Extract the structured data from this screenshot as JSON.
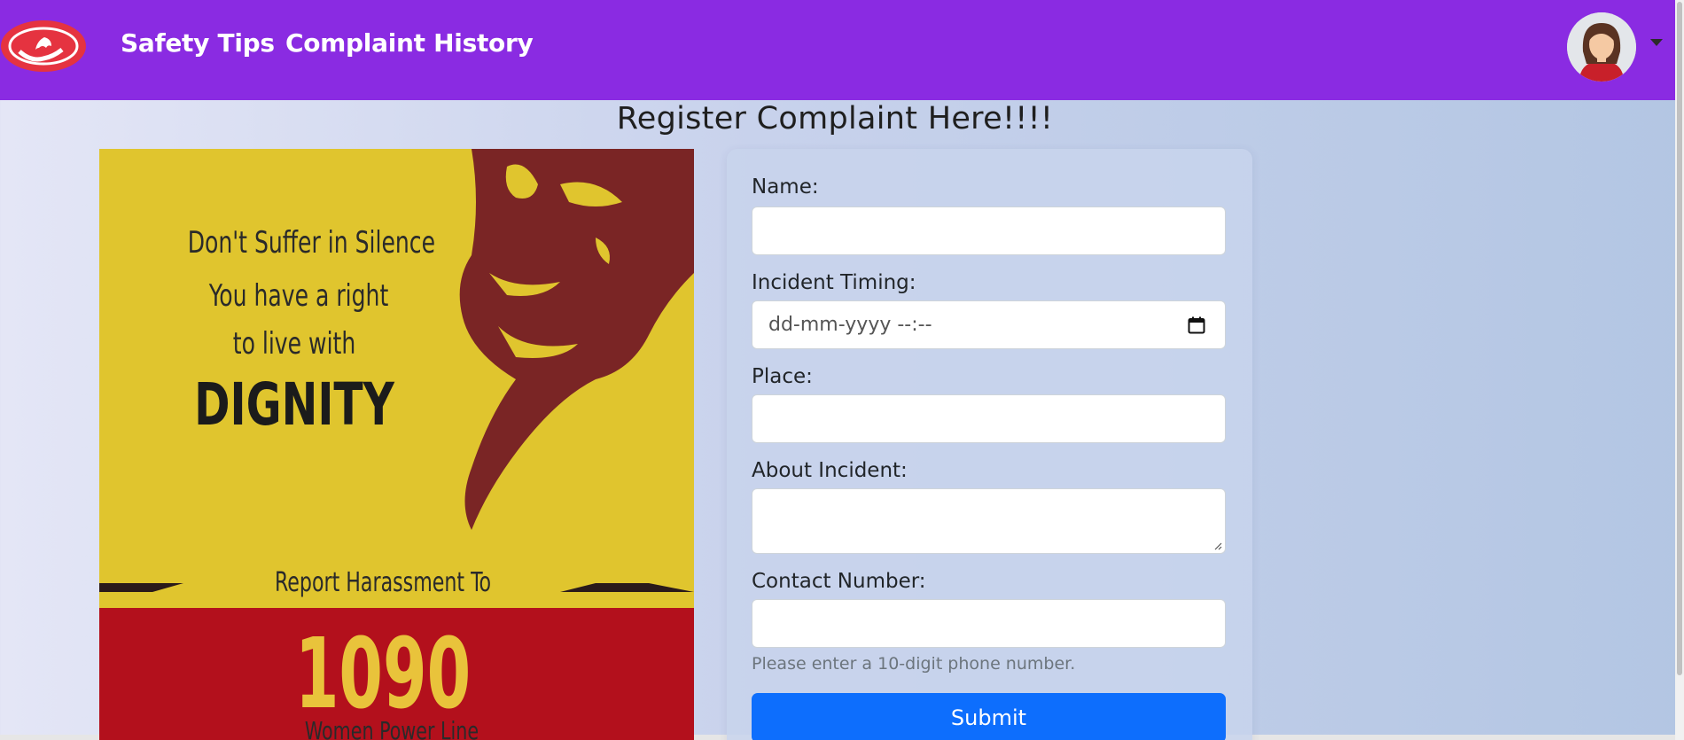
{
  "navbar": {
    "links": [
      "Safety Tips",
      "Complaint History"
    ],
    "brand_color": "#8a2be2"
  },
  "page": {
    "title": "Register Complaint Here!!!!"
  },
  "poster": {
    "line1": "Don't Suffer in Silence",
    "line2": "You have a right",
    "line3": "to live with",
    "line4": "DIGNITY",
    "line5": "Report Harassment To",
    "number": "1090",
    "line6": "Women Power Line"
  },
  "form": {
    "name_label": "Name:",
    "name_value": "",
    "timing_label": "Incident Timing:",
    "timing_placeholder": "dd-mm-yyyy --:--",
    "place_label": "Place:",
    "place_value": "",
    "about_label": "About Incident:",
    "about_value": "",
    "contact_label": "Contact Number:",
    "contact_value": "",
    "contact_help": "Please enter a 10-digit phone number.",
    "submit_label": "Submit",
    "submit_color": "#0d6efd"
  },
  "icons": {
    "logo": "shield-hands-logo-icon",
    "avatar": "user-avatar-icon",
    "caret": "caret-down-icon",
    "calendar": "calendar-icon"
  }
}
